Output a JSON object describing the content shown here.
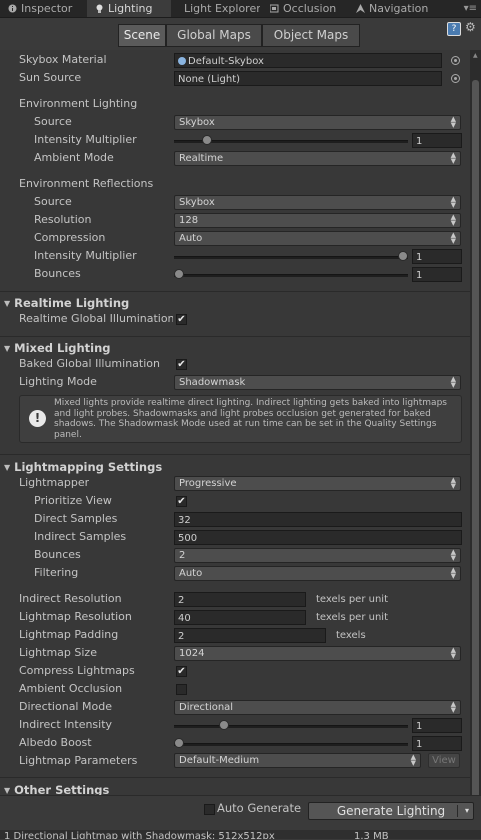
{
  "tabs": [
    {
      "label": "Inspector",
      "icon": "info-icon"
    },
    {
      "label": "Lighting",
      "icon": "lightbulb-icon"
    },
    {
      "label": "Light Explorer",
      "icon": ""
    },
    {
      "label": "Occlusion",
      "icon": "occlusion-icon"
    },
    {
      "label": "Navigation",
      "icon": "navigation-icon"
    }
  ],
  "subtabs": [
    "Scene",
    "Global Maps",
    "Object Maps"
  ],
  "scene": {
    "skybox_material_label": "Skybox Material",
    "skybox_material_value": "Default-Skybox",
    "sun_source_label": "Sun Source",
    "sun_source_value": "None (Light)"
  },
  "env_lighting": {
    "title": "Environment Lighting",
    "source_label": "Source",
    "source_value": "Skybox",
    "intensity_label": "Intensity Multiplier",
    "intensity_value": "1",
    "intensity_fraction": 0.125,
    "ambient_label": "Ambient Mode",
    "ambient_value": "Realtime"
  },
  "env_reflections": {
    "title": "Environment Reflections",
    "source_label": "Source",
    "source_value": "Skybox",
    "resolution_label": "Resolution",
    "resolution_value": "128",
    "compression_label": "Compression",
    "compression_value": "Auto",
    "intensity_label": "Intensity Multiplier",
    "intensity_value": "1",
    "intensity_fraction": 1.0,
    "bounces_label": "Bounces",
    "bounces_value": "1",
    "bounces_fraction": 0.0
  },
  "realtime": {
    "title": "Realtime Lighting",
    "gi_label": "Realtime Global Illumination",
    "gi_checked": true
  },
  "mixed": {
    "title": "Mixed Lighting",
    "baked_label": "Baked Global Illumination",
    "baked_checked": true,
    "mode_label": "Lighting Mode",
    "mode_value": "Shadowmask",
    "help": "Mixed lights provide realtime direct lighting. Indirect lighting gets baked into lightmaps and light probes. Shadowmasks and light probes occlusion get generated for baked shadows. The Shadowmask Mode used at run time can be set in the Quality Settings panel."
  },
  "lightmapping": {
    "title": "Lightmapping Settings",
    "lightmapper_label": "Lightmapper",
    "lightmapper_value": "Progressive",
    "prioritize_label": "Prioritize View",
    "prioritize_checked": true,
    "direct_label": "Direct Samples",
    "direct_value": "32",
    "indirect_samples_label": "Indirect Samples",
    "indirect_samples_value": "500",
    "bounces_label": "Bounces",
    "bounces_value": "2",
    "filtering_label": "Filtering",
    "filtering_value": "Auto",
    "indirect_res_label": "Indirect Resolution",
    "indirect_res_value": "2",
    "indirect_res_unit": "texels per unit",
    "lightmap_res_label": "Lightmap Resolution",
    "lightmap_res_value": "40",
    "lightmap_res_unit": "texels per unit",
    "padding_label": "Lightmap Padding",
    "padding_value": "2",
    "padding_unit": "texels",
    "size_label": "Lightmap Size",
    "size_value": "1024",
    "compress_label": "Compress Lightmaps",
    "compress_checked": true,
    "ao_label": "Ambient Occlusion",
    "ao_checked": false,
    "directional_label": "Directional Mode",
    "directional_value": "Directional",
    "indirect_int_label": "Indirect Intensity",
    "indirect_int_value": "1",
    "indirect_int_fraction": 0.2,
    "albedo_label": "Albedo Boost",
    "albedo_value": "1",
    "albedo_fraction": 0.0,
    "params_label": "Lightmap Parameters",
    "params_value": "Default-Medium",
    "view_label": "View"
  },
  "other_settings_title": "Other Settings",
  "bottom": {
    "auto_generate_label": "Auto Generate",
    "auto_generate_checked": false,
    "generate_label": "Generate Lighting",
    "status_text": "1 Directional Lightmap with Shadowmask: 512x512px",
    "status_size": "1.3 MB"
  }
}
